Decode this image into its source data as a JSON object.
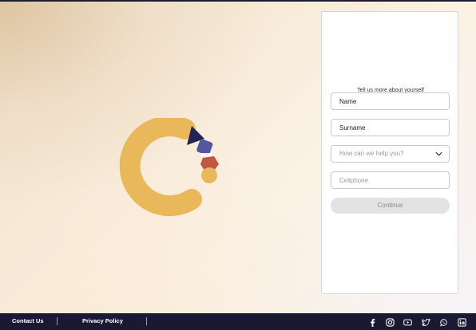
{
  "form": {
    "title": "Tell us more about yourself",
    "name_placeholder": "Name",
    "surname_placeholder": "Surname",
    "help_select_value": "How can we help you?",
    "cellphone_placeholder": "Cellphone",
    "continue_label": "Continue"
  },
  "footer": {
    "contact_label": "Contact Us",
    "privacy_label": "Privacy Policy",
    "social_icons": [
      "facebook-icon",
      "instagram-icon",
      "youtube-icon",
      "twitter-icon",
      "whatsapp-icon",
      "linkedin-icon"
    ]
  },
  "colors": {
    "logo_ring": "#e8b85a",
    "logo_navy": "#242553",
    "logo_purple": "#5456a0",
    "logo_rust": "#c0573e",
    "footer_bg": "#1b1932",
    "button_bg": "#e3e3e3"
  }
}
